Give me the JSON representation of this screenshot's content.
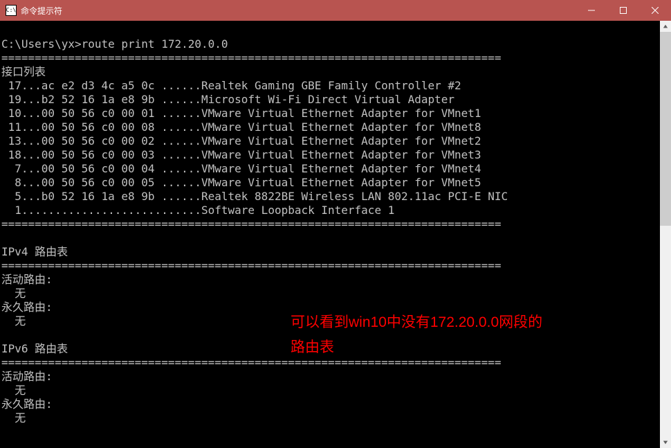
{
  "titlebar": {
    "icon_text": "C:\\",
    "title": "命令提示符"
  },
  "prompt": "C:\\Users\\yx>",
  "command": "route print 172.20.0.0",
  "sep": "===========================================================================",
  "interface_list_header": "接口列表",
  "interfaces": [
    " 17...ac e2 d3 4c a5 0c ......Realtek Gaming GBE Family Controller #2",
    " 19...b2 52 16 1a e8 9b ......Microsoft Wi-Fi Direct Virtual Adapter",
    " 10...00 50 56 c0 00 01 ......VMware Virtual Ethernet Adapter for VMnet1",
    " 11...00 50 56 c0 00 08 ......VMware Virtual Ethernet Adapter for VMnet8",
    " 13...00 50 56 c0 00 02 ......VMware Virtual Ethernet Adapter for VMnet2",
    " 18...00 50 56 c0 00 03 ......VMware Virtual Ethernet Adapter for VMnet3",
    "  7...00 50 56 c0 00 04 ......VMware Virtual Ethernet Adapter for VMnet4",
    "  8...00 50 56 c0 00 05 ......VMware Virtual Ethernet Adapter for VMnet5",
    "  5...b0 52 16 1a e8 9b ......Realtek 8822BE Wireless LAN 802.11ac PCI-E NIC",
    "  1...........................Software Loopback Interface 1"
  ],
  "ipv4_header": "IPv4 路由表",
  "ipv6_header": "IPv6 路由表",
  "active_routes_label": "活动路由:",
  "persistent_routes_label": "永久路由:",
  "none_label": "  无",
  "annotation": "可以看到win10中没有172.20.0.0网段的\n路由表"
}
